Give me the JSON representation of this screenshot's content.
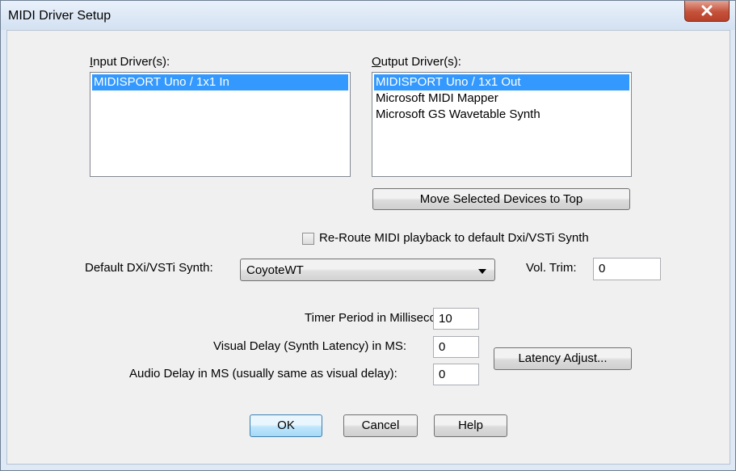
{
  "window": {
    "title": "MIDI Driver Setup"
  },
  "input_drivers": {
    "label_accel": "I",
    "label_rest": "nput Driver(s):",
    "items": [
      "MIDISPORT Uno / 1x1 In"
    ]
  },
  "output_drivers": {
    "label_accel": "O",
    "label_rest": "utput Driver(s):",
    "items": [
      "MIDISPORT Uno / 1x1 Out",
      "Microsoft MIDI Mapper",
      "Microsoft GS Wavetable Synth"
    ]
  },
  "move_button_label": "Move Selected Devices to Top",
  "reroute": {
    "label": "Re-Route MIDI playback to default Dxi/VSTi Synth",
    "checked": false
  },
  "synth": {
    "label": "Default DXi/VSTi Synth:",
    "value": "CoyoteWT"
  },
  "vol_trim": {
    "label": "Vol. Trim:",
    "value": "0"
  },
  "timer": {
    "label": "Timer Period in Milliseconds:",
    "value": "10"
  },
  "visual_delay": {
    "label": "Visual Delay (Synth Latency) in MS:",
    "value": "0"
  },
  "latency_button_label": "Latency Adjust...",
  "audio_delay": {
    "label": "Audio Delay in MS (usually same as visual delay):",
    "value": "0"
  },
  "buttons": {
    "ok": "OK",
    "cancel": "Cancel",
    "help": "Help"
  },
  "icons": {
    "close": "close-icon",
    "dropdown": "chevron-down-icon"
  }
}
